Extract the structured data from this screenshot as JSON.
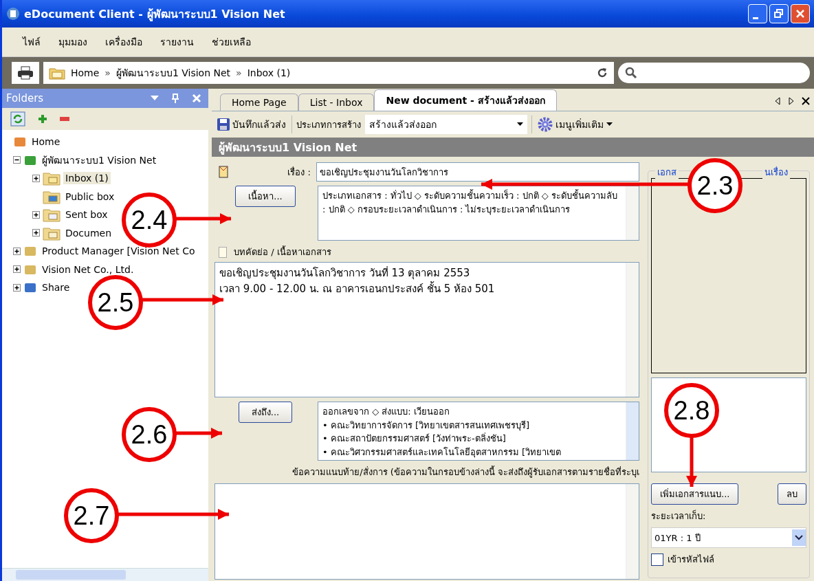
{
  "window": {
    "title": "eDocument Client - ผู้พัฒนาระบบ1 Vision Net"
  },
  "menu": [
    "ไฟล์",
    "มุมมอง",
    "เครื่องมือ",
    "รายงาน",
    "ช่วยเหลือ"
  ],
  "address": {
    "separator": "»",
    "crumbs": [
      "Home",
      "ผู้พัฒนาระบบ1 Vision Net",
      "Inbox (1)"
    ]
  },
  "folders": {
    "title": "Folders",
    "tree": [
      {
        "label": "Home",
        "selected": false
      },
      {
        "label": "ผู้พัฒนาระบบ1 Vision Net",
        "expanded": true,
        "selected": false,
        "children": [
          {
            "label": "Inbox (1)",
            "expanded": false,
            "selected": true
          },
          {
            "label": "Public box",
            "selected": false
          },
          {
            "label": "Sent box",
            "expanded": false,
            "selected": false
          },
          {
            "label": "Documen",
            "expanded": false,
            "selected": false
          }
        ]
      },
      {
        "label": "Product Manager [Vision Net Co",
        "expanded": false,
        "selected": false
      },
      {
        "label": "Vision Net Co., Ltd.",
        "expanded": false,
        "selected": false
      },
      {
        "label": "Share",
        "expanded": false,
        "selected": false
      }
    ]
  },
  "tabs": [
    {
      "label": "Home Page",
      "selected": false
    },
    {
      "label": "List - Inbox",
      "selected": false
    },
    {
      "label": "New document - สร้างแล้วส่งออก",
      "selected": true
    }
  ],
  "toolbar": {
    "save": "บันทึกแล้วส่ง",
    "type_label": "ประเภทการสร้าง",
    "type_value": "สร้างแล้วส่งออก",
    "more": "เมนูเพิ่มเติม"
  },
  "header": "ผู้พัฒนาระบบ1 Vision Net",
  "form": {
    "subject_label": "เรื่อง :",
    "subject": "ขอเชิญประชุมงานวันโลกวิชาการ",
    "content_button": "เนื้อหา...",
    "content_info": "ประเภทเอกสาร : ทั่วไป ◇ ระดับความชั้นความเร็ว : ปกติ ◇ ระดับชั้นความลับ : ปกติ ◇ กรอบระยะเวลาดำเนินการ : ไม่ระบุระยะเวลาดำเนินการ",
    "abstract_label": "บทคัดย่อ / เนื้อหาเอกสาร",
    "abstract_lines": [
      "ขอเชิญประชุมงานวันโลกวิชาการ วันที่ 13 ตุลาคม 2553",
      "เวลา 9.00 - 12.00 น.  ณ  อาคารเอนกประสงค์ ชั้น 5 ห้อง 501"
    ],
    "send_button": "ส่งถึง...",
    "recipients": [
      "ออกเลขจาก ◇ ส่งแบบ: เวียนออก",
      "• คณะวิทยาการจัดการ [วิทยาเขตสารสนเทศเพชรบุรี]",
      "• คณะสถาปัตยกรรมศาสตร์ [วังท่าพระ-ตลิ่งชัน]",
      "• คณะวิศวกรรมศาสตร์และเทคโนโลยีอุตสาหกรรม [วิทยาเขต"
    ],
    "note_label": "ข้อความแนบท้าย/สั่งการ (ข้อความในกรอบข้างล่างนี้ จะส่งถึงผู้รับเอกสารตามรายชื่อที่ระบุเ"
  },
  "attachments": {
    "legend": [
      "เอกส",
      "นเรื่อง"
    ],
    "add_button": "เพิ่มเอกสารแนบ...",
    "delete_button": "ลบ",
    "retention_label": "ระยะเวลาเก็บ:",
    "retention_value": "01YR : 1 ปี",
    "encrypt_label": "เข้ารหัสไฟล์",
    "encrypt": false
  },
  "callouts": [
    {
      "label": "2.3"
    },
    {
      "label": "2.4"
    },
    {
      "label": "2.5"
    },
    {
      "label": "2.6"
    },
    {
      "label": "2.7"
    },
    {
      "label": "2.8"
    }
  ]
}
